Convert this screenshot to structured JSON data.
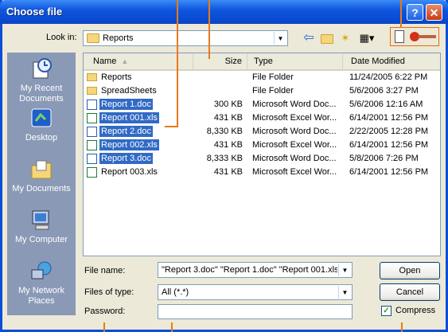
{
  "window": {
    "title": "Choose file",
    "help_glyph": "?",
    "close_glyph": "✕"
  },
  "toolbar": {
    "look_in_label": "Look in:",
    "look_in_value": "Reports",
    "icons": [
      "back-icon",
      "up-folder-icon",
      "new-folder-icon",
      "views-menu-icon",
      "encryption-key-icon"
    ]
  },
  "places": [
    {
      "label": "My Recent Documents",
      "icon": "recent-documents-icon"
    },
    {
      "label": "Desktop",
      "icon": "desktop-icon"
    },
    {
      "label": "My Documents",
      "icon": "my-documents-icon"
    },
    {
      "label": "My Computer",
      "icon": "my-computer-icon"
    },
    {
      "label": "My Network Places",
      "icon": "network-places-icon"
    }
  ],
  "columns": {
    "name": "Name",
    "size": "Size",
    "type": "Type",
    "date": "Date Modified"
  },
  "files": [
    {
      "name": "Reports",
      "size": "",
      "type": "File Folder",
      "date": "11/24/2005 6:22 PM",
      "kind": "folder",
      "selected": false
    },
    {
      "name": "SpreadSheets",
      "size": "",
      "type": "File Folder",
      "date": "5/6/2006 3:27 PM",
      "kind": "folder",
      "selected": false
    },
    {
      "name": "Report 1.doc",
      "size": "300 KB",
      "type": "Microsoft Word Doc...",
      "date": "5/6/2006 12:16 AM",
      "kind": "doc",
      "selected": true
    },
    {
      "name": "Report 001.xls",
      "size": "431 KB",
      "type": "Microsoft Excel Wor...",
      "date": "6/14/2001 12:56 PM",
      "kind": "xls",
      "selected": true
    },
    {
      "name": "Report 2.doc",
      "size": "8,330 KB",
      "type": "Microsoft Word Doc...",
      "date": "2/22/2005 12:28 PM",
      "kind": "doc",
      "selected": true
    },
    {
      "name": "Report 002.xls",
      "size": "431 KB",
      "type": "Microsoft Excel Wor...",
      "date": "6/14/2001 12:56 PM",
      "kind": "xls",
      "selected": true
    },
    {
      "name": "Report 3.doc",
      "size": "8,333 KB",
      "type": "Microsoft Word Doc...",
      "date": "5/8/2006 7:26 PM",
      "kind": "doc",
      "selected": true
    },
    {
      "name": "Report 003.xls",
      "size": "431 KB",
      "type": "Microsoft Excel Wor...",
      "date": "6/14/2001 12:56 PM",
      "kind": "xls",
      "selected": false
    }
  ],
  "form": {
    "file_name_label": "File name:",
    "file_name_value": "\"Report 3.doc\" \"Report 1.doc\" \"Report 001.xls",
    "file_type_label": "Files of type:",
    "file_type_value": "All (*.*)",
    "password_label": "Password:",
    "password_value": ""
  },
  "buttons": {
    "open": "Open",
    "cancel": "Cancel"
  },
  "compress": {
    "label": "Compress",
    "checked": true,
    "mark": "✓"
  },
  "colors": {
    "accent": "#0a4fd6",
    "selection": "#316ac5",
    "callout": "#e87a1c"
  }
}
